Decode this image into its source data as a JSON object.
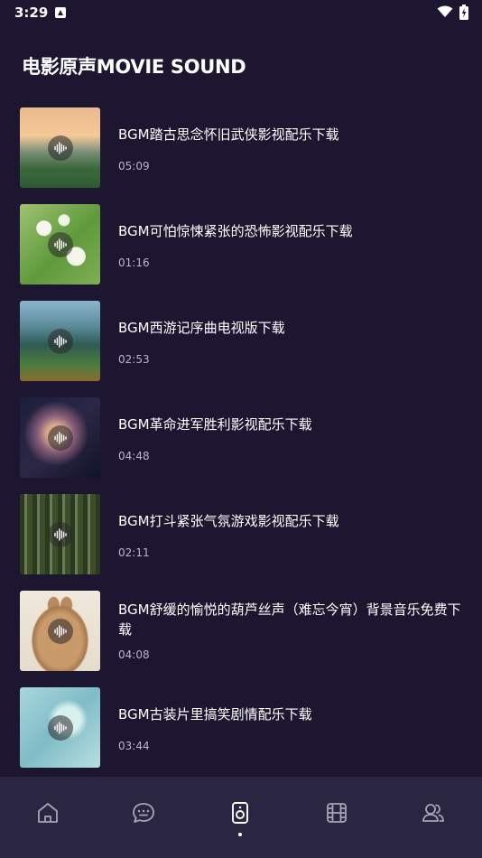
{
  "status_bar": {
    "time": "3:29"
  },
  "page": {
    "title": "电影原声MOVIE SOUND"
  },
  "tracks": [
    {
      "title": "BGM踏古思念怀旧武侠影视配乐下载",
      "duration": "05:09"
    },
    {
      "title": "BGM可怕惊悚紧张的恐怖影视配乐下载",
      "duration": "01:16"
    },
    {
      "title": "BGM西游记序曲电视版下载",
      "duration": "02:53"
    },
    {
      "title": "BGM革命进军胜利影视配乐下载",
      "duration": "04:48"
    },
    {
      "title": "BGM打斗紧张气氛游戏影视配乐下载",
      "duration": "02:11"
    },
    {
      "title": "BGM舒缓的愉悦的葫芦丝声（难忘今宵）背景音乐免费下载",
      "duration": "04:08"
    },
    {
      "title": "BGM古装片里搞笑剧情配乐下载",
      "duration": "03:44"
    }
  ],
  "bottom_nav": {
    "items": [
      {
        "icon": "home-icon",
        "active": false
      },
      {
        "icon": "chat-icon",
        "active": false
      },
      {
        "icon": "speaker-icon",
        "active": true
      },
      {
        "icon": "film-icon",
        "active": false
      },
      {
        "icon": "users-icon",
        "active": false
      }
    ]
  },
  "colors": {
    "background": "#1d1630",
    "nav_background": "#2a2642",
    "secondary_text": "#b9b5c6"
  }
}
